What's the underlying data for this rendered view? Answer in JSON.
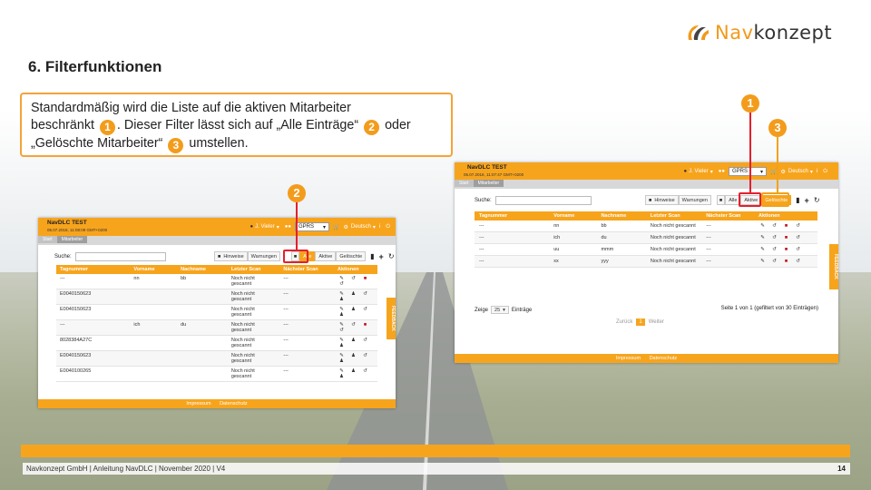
{
  "brand": {
    "nav": "Nav",
    "konzept": "konzept"
  },
  "title": "6. Filterfunktionen",
  "callout": {
    "line1": "Standardmäßig wird die Liste auf die aktiven Mitarbeiter",
    "line2a": "beschränkt",
    "line2b": ". Dieser Filter lässt sich auf „Alle Einträge“",
    "line2c": "oder",
    "line3a": "„Gelöschte Mitarbeiter“",
    "line3b": "umstellen.",
    "badges": [
      "1",
      "2",
      "3"
    ]
  },
  "markers": [
    "1",
    "2",
    "3"
  ],
  "app": {
    "name": "NavDLC TEST",
    "date_left": "05.07.2018, 11:08:09 GMT+0200",
    "date_right": "05.07.2018, 11:07:47 GMT+0200",
    "user": "J. Vieler",
    "gprs": "GPRS",
    "language": "Deutsch",
    "breadcrumb": [
      "Start",
      "Mitarbeiter"
    ],
    "search_label": "Suche:",
    "hint_buttons": [
      "Hinweise",
      "Warnungen"
    ],
    "filter_buttons": [
      "Alle",
      "Aktive",
      "Gelöschte"
    ],
    "columns": [
      "Tagnummer",
      "Vorname",
      "Nachname",
      "Letzter Scan",
      "Nächster Scan",
      "Aktionen"
    ],
    "never_scanned": "Noch nicht gescannt",
    "dash": "---",
    "footer": [
      "Impressum",
      "Datenschutz"
    ],
    "feedback": "FEEDBACK"
  },
  "left_table": [
    {
      "tag": "---",
      "vor": "nn",
      "nach": "bb",
      "next": "---",
      "deleted": false
    },
    {
      "tag": "E0040150623",
      "vor": "",
      "nach": "",
      "next": "---",
      "deleted": true
    },
    {
      "tag": "E0040150623",
      "vor": "",
      "nach": "",
      "next": "---",
      "deleted": true
    },
    {
      "tag": "---",
      "vor": "ich",
      "nach": "du",
      "next": "---",
      "deleted": false
    },
    {
      "tag": "8028384A27C",
      "vor": "",
      "nach": "",
      "next": "---",
      "deleted": true
    },
    {
      "tag": "E0040150623",
      "vor": "",
      "nach": "",
      "next": "---",
      "deleted": true
    },
    {
      "tag": "E0040100265",
      "vor": "",
      "nach": "",
      "next": "---",
      "deleted": true
    }
  ],
  "right_table": [
    {
      "tag": "---",
      "vor": "nn",
      "nach": "bb",
      "next": "---"
    },
    {
      "tag": "---",
      "vor": "ich",
      "nach": "du",
      "next": "---"
    },
    {
      "tag": "---",
      "vor": "uu",
      "nach": "mmm",
      "next": "---"
    },
    {
      "tag": "---",
      "vor": "xx",
      "nach": "yyy",
      "next": "---"
    }
  ],
  "pagination": {
    "show_label": "Zeige",
    "page_size": "25",
    "entries_label": "Einträge",
    "summary": "Seite 1 von 1 (gefiltert von 30 Einträgen)",
    "prev": "Zurück",
    "current": "1",
    "next": "Weiter"
  },
  "footer": {
    "text": "Navkonzept GmbH  |  Anleitung NavDLC  |  November 2020  |  V4",
    "page": "14"
  },
  "colors": {
    "accent": "#f7a41d",
    "highlight": "#e3202e",
    "marker": "#f39c1c"
  }
}
